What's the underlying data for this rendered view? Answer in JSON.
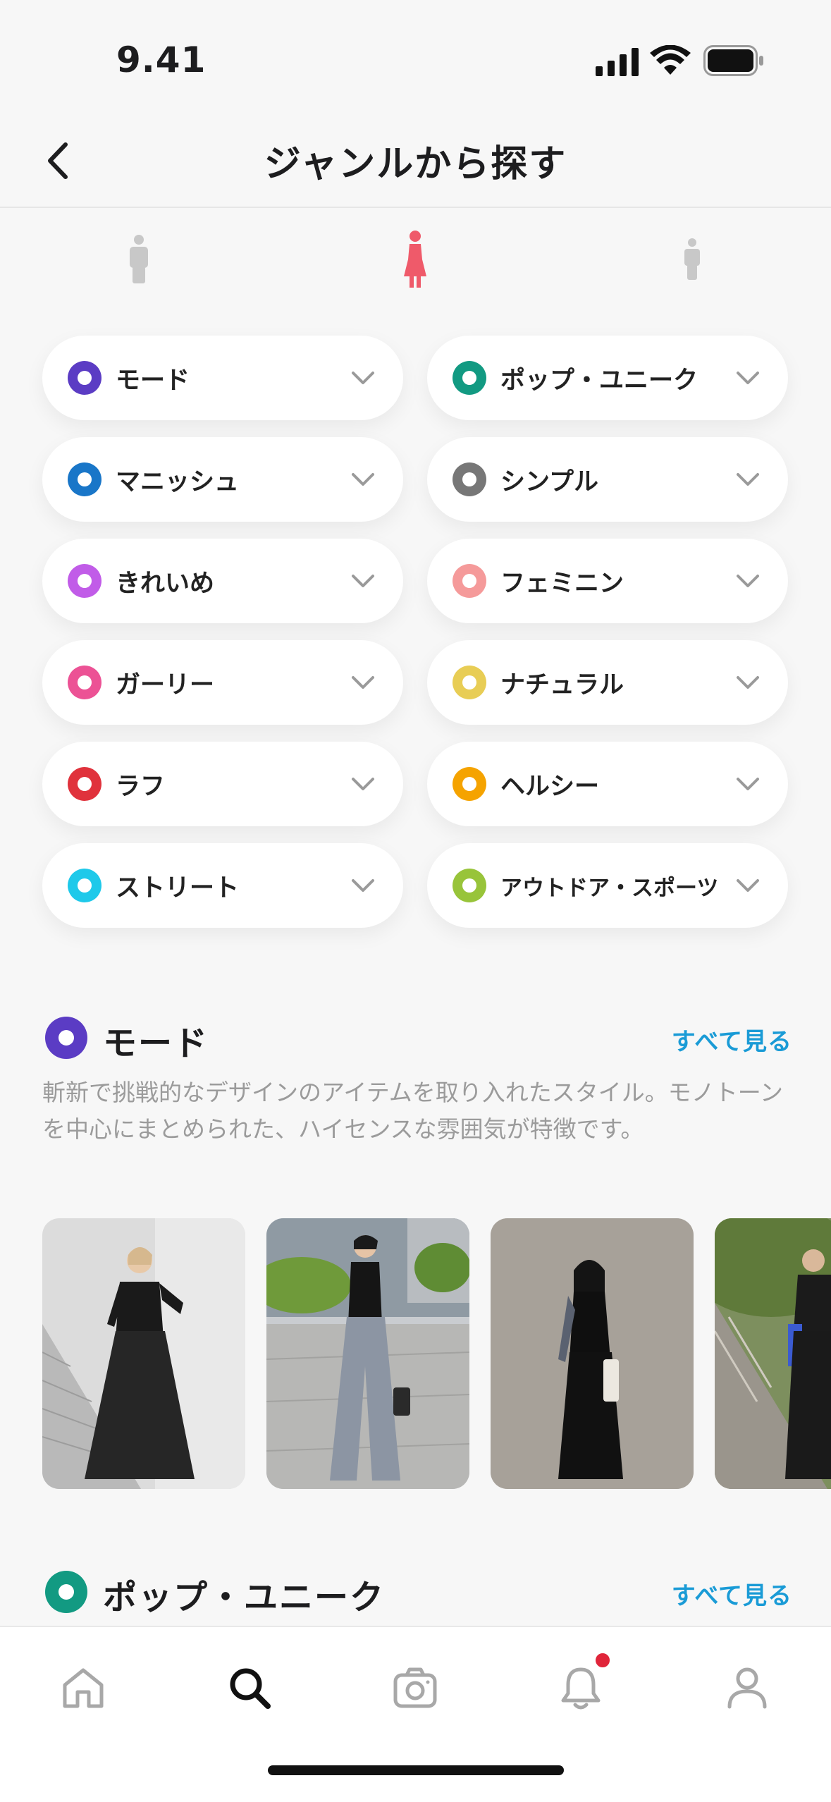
{
  "status_bar": {
    "time": "9.41"
  },
  "header": {
    "title": "ジャンルから探す"
  },
  "gender_tabs": [
    {
      "name": "person-icon",
      "selected": false,
      "color": "#c8c8c8"
    },
    {
      "name": "woman-icon",
      "selected": true,
      "color": "#ef5a6a"
    },
    {
      "name": "child-icon",
      "selected": false,
      "color": "#c8c8c8"
    }
  ],
  "genres": [
    {
      "label": "モード",
      "color": "#5b3cc4"
    },
    {
      "label": "ポップ・ユニーク",
      "color": "#129a82"
    },
    {
      "label": "マニッシュ",
      "color": "#1976c8"
    },
    {
      "label": "シンプル",
      "color": "#777777"
    },
    {
      "label": "きれいめ",
      "color": "#c15ce8"
    },
    {
      "label": "フェミニン",
      "color": "#f59a9a"
    },
    {
      "label": "ガーリー",
      "color": "#ec5295"
    },
    {
      "label": "ナチュラル",
      "color": "#e8cd55"
    },
    {
      "label": "ラフ",
      "color": "#e0323c"
    },
    {
      "label": "ヘルシー",
      "color": "#f5a300"
    },
    {
      "label": "ストリート",
      "color": "#1ec9ea"
    },
    {
      "label": "アウトドア・スポーツ",
      "color": "#98c43a"
    }
  ],
  "sections": [
    {
      "title": "モード",
      "color": "#5b3cc4",
      "see_all": "すべて見る",
      "description": "斬新で挑戦的なデザインのアイテムを取り入れたスタイル。モノトーンを中心にまとめられた、ハイセンスな雰囲気が特徴です。"
    },
    {
      "title": "ポップ・ユニーク",
      "color": "#129a82",
      "see_all": "すべて見る"
    }
  ],
  "tab_bar": {
    "items": [
      "home-icon",
      "search-icon",
      "camera-icon",
      "bell-icon",
      "profile-icon"
    ],
    "active": "search-icon",
    "notification_badge": true
  }
}
